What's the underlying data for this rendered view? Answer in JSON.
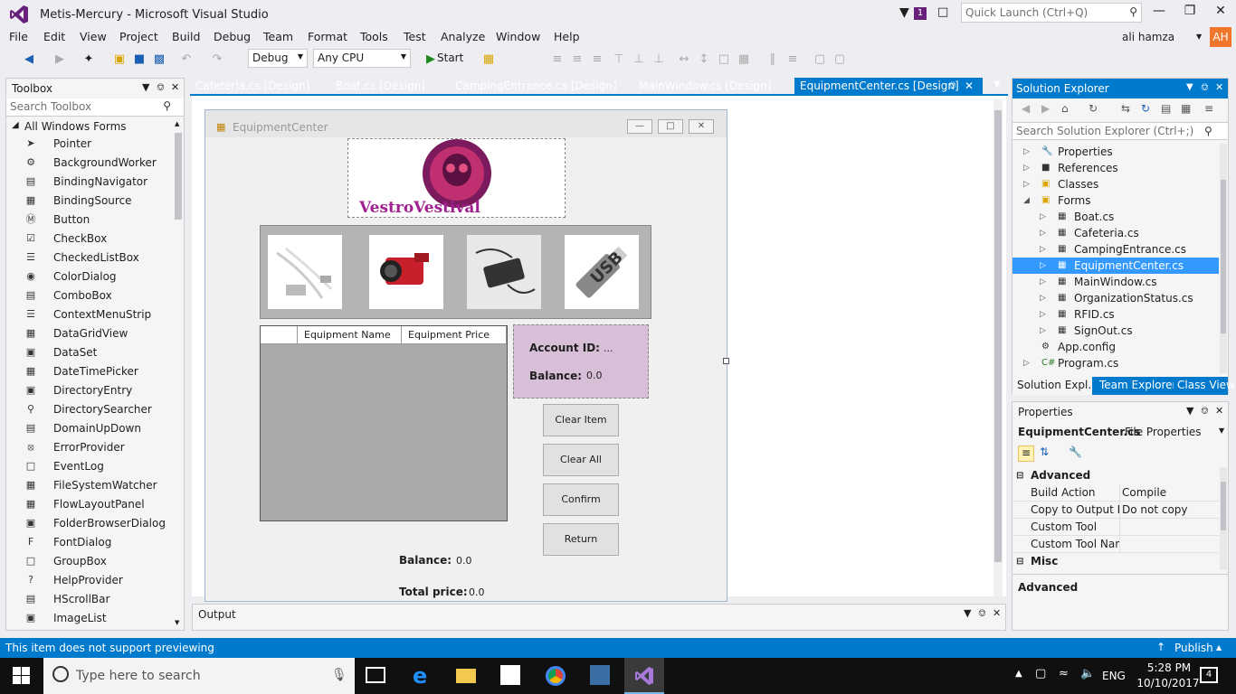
{
  "window": {
    "title": "Metis-Mercury - Microsoft Visual Studio",
    "notifications_count": "1",
    "quick_launch_placeholder": "Quick Launch (Ctrl+Q)"
  },
  "menu": [
    "File",
    "Edit",
    "View",
    "Project",
    "Build",
    "Debug",
    "Team",
    "Format",
    "Tools",
    "Test",
    "Analyze",
    "Window",
    "Help"
  ],
  "user": {
    "name": "ali hamza",
    "initials": "AH"
  },
  "toolbar": {
    "config": "Debug",
    "platform": "Any CPU",
    "start_label": "Start"
  },
  "toolbox": {
    "title": "Toolbox",
    "search_placeholder": "Search Toolbox",
    "group": "All Windows Forms",
    "items": [
      "Pointer",
      "BackgroundWorker",
      "BindingNavigator",
      "BindingSource",
      "Button",
      "CheckBox",
      "CheckedListBox",
      "ColorDialog",
      "ComboBox",
      "ContextMenuStrip",
      "DataGridView",
      "DataSet",
      "DateTimePicker",
      "DirectoryEntry",
      "DirectorySearcher",
      "DomainUpDown",
      "ErrorProvider",
      "EventLog",
      "FileSystemWatcher",
      "FlowLayoutPanel",
      "FolderBrowserDialog",
      "FontDialog",
      "GroupBox",
      "HelpProvider",
      "HScrollBar",
      "ImageList"
    ]
  },
  "doc_tabs": [
    "Cafeteria.cs [Design]",
    "Boat.cs [Design]",
    "CampingEntrance.cs [Design]",
    "MainWindow.cs [Design]",
    "EquipmentCenter.cs [Design]"
  ],
  "form": {
    "title": "EquipmentCenter",
    "logo_text": "VestroVestival",
    "images": [
      "cables",
      "camera",
      "charger",
      "USB"
    ],
    "grid_columns": [
      "Equipment Name",
      "Equipment Price"
    ],
    "account_id_label": "Account ID:",
    "account_id_value": "...",
    "balance_label": "Balance:",
    "balance_value": "0.0",
    "buttons": [
      "Clear Item",
      "Clear All",
      "Confirm",
      "Return"
    ],
    "bottom_balance_label": "Balance:",
    "bottom_balance_value": "0.0",
    "total_price_label": "Total price:",
    "total_price_value": "0.0"
  },
  "output": {
    "title": "Output"
  },
  "solution_explorer": {
    "title": "Solution Explorer",
    "search_placeholder": "Search Solution Explorer (Ctrl+;)",
    "items": [
      "Properties",
      "References",
      "Classes",
      "Forms",
      "Boat.cs",
      "Cafeteria.cs",
      "CampingEntrance.cs",
      "EquipmentCenter.cs",
      "MainWindow.cs",
      "OrganizationStatus.cs",
      "RFID.cs",
      "SignOut.cs",
      "App.config",
      "Program.cs"
    ],
    "bottom_tabs": [
      "Solution Expl...",
      "Team Explorer",
      "Class View"
    ]
  },
  "properties": {
    "title": "Properties",
    "object": "EquipmentCenter.cs",
    "object_type": "File Properties",
    "section_advanced": "Advanced",
    "rows": [
      {
        "name": "Build Action",
        "value": "Compile"
      },
      {
        "name": "Copy to Output Di",
        "value": "Do not copy"
      },
      {
        "name": "Custom Tool",
        "value": ""
      },
      {
        "name": "Custom Tool Nam",
        "value": ""
      }
    ],
    "section_misc": "Misc",
    "description": "Advanced"
  },
  "status": {
    "message": "This item does not support previewing",
    "publish": "Publish"
  },
  "taskbar": {
    "search_placeholder": "Type here to search",
    "lang": "ENG",
    "time": "5:28 PM",
    "date": "10/10/2017",
    "notif_count": "4"
  },
  "colors": {
    "accent": "#007acc",
    "vs_purple": "#68217a",
    "selection": "#3399ff",
    "account_panel": "#d8bfd8"
  }
}
